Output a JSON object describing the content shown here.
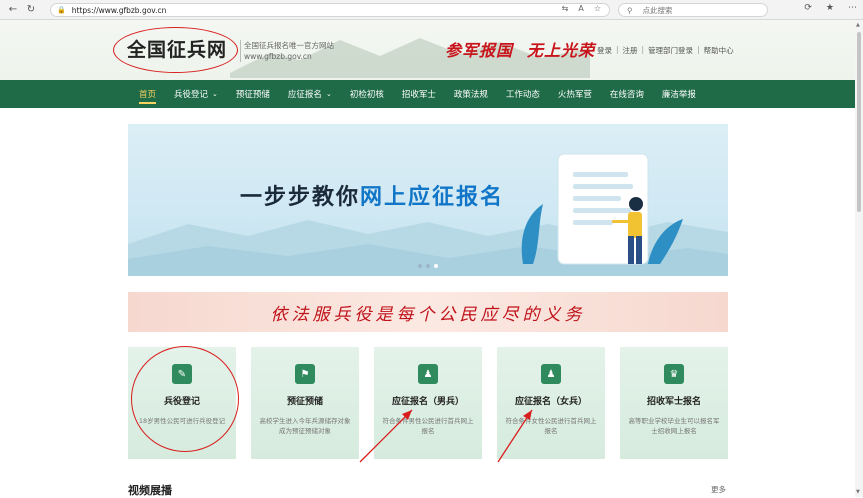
{
  "browser": {
    "url": "https://www.gfbzb.gov.cn",
    "search_placeholder": "点此搜索"
  },
  "header": {
    "logo": "全国征兵网",
    "subtitle_line1": "全国征兵报名唯一官方网站",
    "subtitle_line2": "www.gfbzb.gov.cn",
    "slogan_left": "参军报国",
    "slogan_right": "无上光荣",
    "links": [
      "登录",
      "注册",
      "管理部门登录",
      "帮助中心"
    ]
  },
  "nav": {
    "items": [
      {
        "label": "首页",
        "active": true,
        "caret": false
      },
      {
        "label": "兵役登记",
        "active": false,
        "caret": true
      },
      {
        "label": "预征预储",
        "active": false,
        "caret": false
      },
      {
        "label": "应征报名",
        "active": false,
        "caret": true
      },
      {
        "label": "初检初核",
        "active": false,
        "caret": false
      },
      {
        "label": "招收军士",
        "active": false,
        "caret": false
      },
      {
        "label": "政策法规",
        "active": false,
        "caret": false
      },
      {
        "label": "工作动态",
        "active": false,
        "caret": false
      },
      {
        "label": "火热军营",
        "active": false,
        "caret": false
      },
      {
        "label": "在线咨询",
        "active": false,
        "caret": false
      },
      {
        "label": "廉洁举报",
        "active": false,
        "caret": false
      }
    ]
  },
  "banner": {
    "title_prefix": "一步步教你",
    "title_highlight": "网上应征报名"
  },
  "motto": "依法服兵役是每个公民应尽的义务",
  "cards": [
    {
      "title": "兵役登记",
      "desc": "18岁男性公民可进行兵役登记",
      "icon": "edit-icon"
    },
    {
      "title": "预征预储",
      "desc": "高校学生进入今年兵源储存对象成为预征预储对象",
      "icon": "flag-icon"
    },
    {
      "title": "应征报名（男兵）",
      "desc": "符合条件男性公民进行首兵网上报名",
      "icon": "male-icon"
    },
    {
      "title": "应征报名（女兵）",
      "desc": "符合条件女性公民进行首兵网上报名",
      "icon": "female-icon"
    },
    {
      "title": "招收军士报名",
      "desc": "高等职业学校毕业生可以报名军士招收网上报名",
      "icon": "cap-icon"
    }
  ],
  "section": {
    "title": "视频展播",
    "more": "更多"
  },
  "colors": {
    "nav_bg": "#1f6b47",
    "nav_active": "#f7d25f",
    "annotation_red": "#d81e1e",
    "card_icon": "#2f8a5d"
  }
}
